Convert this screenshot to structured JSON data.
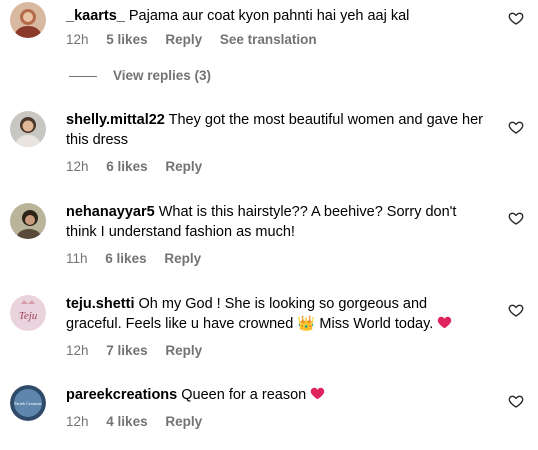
{
  "comments": [
    {
      "username": "_kaarts_",
      "text": "Pajama aur coat kyon pahnti hai yeh aaj kal",
      "time": "12h",
      "likes": "5 likes",
      "reply": "Reply",
      "translate": "See translation"
    },
    {
      "username": "shelly.mittal22",
      "text": "They got the most beautiful women and gave her this dress",
      "time": "12h",
      "likes": "6 likes",
      "reply": "Reply"
    },
    {
      "username": "nehanayyar5",
      "text": "What is this hairstyle?? A beehive? Sorry don't think I understand fashion as much!",
      "time": "11h",
      "likes": "6 likes",
      "reply": "Reply"
    },
    {
      "username": "teju.shetti",
      "text_before": "Oh my God ! She is looking so gorgeous and graceful. Feels like u have crowned",
      "emoji": "👑",
      "text_after": "Miss World today.",
      "time": "12h",
      "likes": "7 likes",
      "reply": "Reply",
      "avatar_text": "Teju"
    },
    {
      "username": "pareekcreations",
      "text": "Queen for a reason",
      "time": "12h",
      "likes": "4 likes",
      "reply": "Reply",
      "avatar_text": "Pareek Creations"
    }
  ],
  "view_replies": "View replies (3)",
  "icons": {
    "like": "heart-outline-icon",
    "emoji_heart": "red-heart-icon",
    "emoji_crown": "crown-icon"
  },
  "colors": {
    "meta": "#737373",
    "heart_emoji": "#e0245e"
  }
}
